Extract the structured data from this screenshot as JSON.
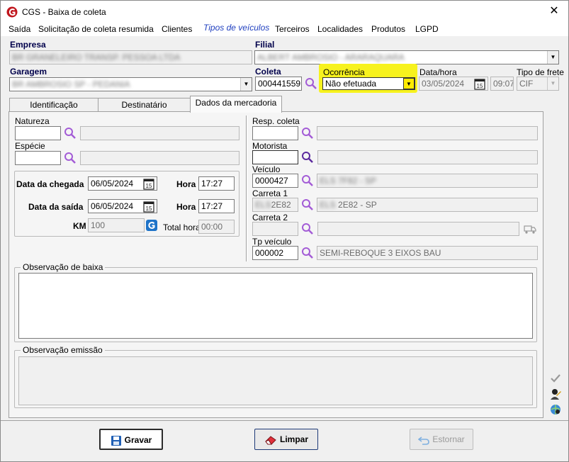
{
  "window": {
    "title": "CGS - Baixa de coleta"
  },
  "menu": [
    "Saída",
    "Solicitação de coleta resumida",
    "Clientes",
    "Tipos de veículos",
    "Terceiros",
    "Localidades",
    "Produtos",
    "LGPD"
  ],
  "header": {
    "empresa_label": "Empresa",
    "empresa_value": "BR GRANELEIRO TRANSP. PESSOA LTDA",
    "filial_label": "Filial",
    "filial_value": "ALBERT AMBROSIO - ARARAQUARA",
    "garagem_label": "Garagem",
    "garagem_value": "BR AMBROSIO SP - PEDANIA",
    "coleta_label": "Coleta",
    "coleta_value": "000441559",
    "ocorrencia_label": "Ocorrência",
    "ocorrencia_value": "Não efetuada",
    "datahora_label": "Data/hora",
    "data_value": "03/05/2024",
    "hora_value": "09:07",
    "tipo_frete_label": "Tipo de frete",
    "tipo_frete_value": "CIF",
    "highlight_color": "#f7f21e"
  },
  "tabs": [
    "Identificação",
    "Destinatário",
    "Dados da mercadoria"
  ],
  "left": {
    "natureza_label": "Natureza",
    "especie_label": "Espécie",
    "data_chegada_label": "Data da chegada",
    "data_chegada_value": "06/05/2024",
    "hora_label": "Hora",
    "hora_chegada_value": "17:27",
    "data_saida_label": "Data da saída",
    "data_saida_value": "06/05/2024",
    "hora_saida_value": "17:27",
    "km_label": "KM",
    "km_value": "100",
    "total_hora_label": "Total hora",
    "total_hora_value": "00:00"
  },
  "right": {
    "resp_coleta_label": "Resp. coleta",
    "motorista_label": "Motorista",
    "veiculo_label": "Veículo",
    "veiculo_value": "0000427",
    "veiculo_desc": "ELS 7F82 - SP",
    "carreta1_label": "Carreta 1",
    "carreta1_value": "2E82",
    "carreta1_code_blur": "ELS",
    "carreta1_desc": "2E82 - SP",
    "carreta1_desc_blur": "ELS",
    "carreta2_label": "Carreta 2",
    "tp_veiculo_label": "Tp veículo",
    "tp_veiculo_value": "000002",
    "tp_veiculo_desc": "SEMI-REBOQUE 3 EIXOS BAU"
  },
  "obs": {
    "baixa_label": "Observação de baixa",
    "emissao_label": "Observação emissão"
  },
  "buttons": {
    "gravar": "Gravar",
    "limpar": "Limpar",
    "estornar": "Estornar"
  }
}
